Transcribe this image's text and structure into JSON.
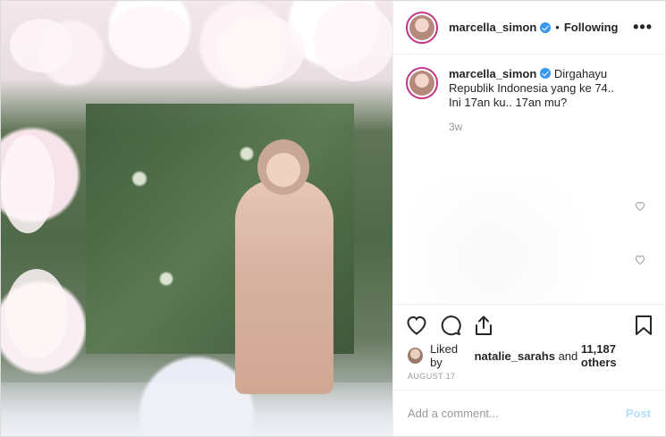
{
  "header": {
    "username": "marcella_simon",
    "verified": true,
    "separator": "•",
    "follow_status": "Following",
    "more_label": "•••"
  },
  "caption": {
    "username": "marcella_simon",
    "line1": "Dirgahayu Republik Indonesia yang ke 74..",
    "line2": "Ini 17an ku.. 17an mu?",
    "time": "3w"
  },
  "actions": {
    "icons": [
      "heart-icon",
      "comment-icon",
      "share-icon",
      "bookmark-icon"
    ]
  },
  "likes": {
    "prefix": "Liked by",
    "user": "natalie_sarahs",
    "joiner": "and",
    "others": "11,187 others"
  },
  "post_date": "AUGUST 17",
  "add_comment": {
    "placeholder": "Add a comment...",
    "post_label": "Post"
  },
  "colors": {
    "verified": "#3897f0",
    "post_disabled": "#b2dffc",
    "avatar_ring": "#c13584"
  }
}
